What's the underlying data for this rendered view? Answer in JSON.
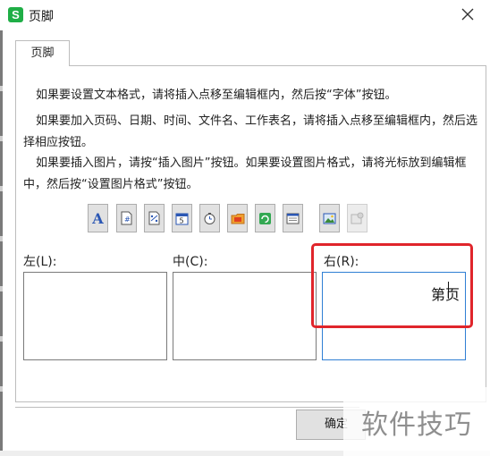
{
  "window": {
    "app_icon_letter": "S",
    "title": "页脚"
  },
  "tab": {
    "label": "页脚"
  },
  "instructions": [
    "如果要设置文本格式，请将插入点移至编辑框内，然后按“字体”按钮。",
    "如果要加入页码、日期、时间、文件名、工作表名，请将插入点移至编辑框内，然后选择相应按钮。",
    "如果要插入图片，请按“插入图片”按钮。如果要设置图片格式，请将光标放到编辑框中，然后按“设置图片格式”按钮。"
  ],
  "toolbar": {
    "font_glyph": "A",
    "buttons": [
      {
        "icon": "font-icon"
      },
      {
        "icon": "page-number-icon"
      },
      {
        "icon": "total-pages-icon"
      },
      {
        "icon": "date-icon"
      },
      {
        "icon": "time-icon"
      },
      {
        "icon": "file-path-icon"
      },
      {
        "icon": "file-name-icon"
      },
      {
        "icon": "sheet-name-icon"
      },
      {
        "icon": "insert-picture-icon"
      },
      {
        "icon": "format-picture-icon",
        "disabled": true
      }
    ]
  },
  "sections": {
    "left_label": "左(L):",
    "center_label": "中(C):",
    "right_label": "右(R):",
    "left_value": "",
    "center_value": "",
    "right_value": "第页"
  },
  "buttons": {
    "ok": "确定"
  },
  "watermark": "软件技巧",
  "colors": {
    "accent": "#2f7fd4",
    "highlight": "#e0252b",
    "app_icon": "#1fae46"
  }
}
